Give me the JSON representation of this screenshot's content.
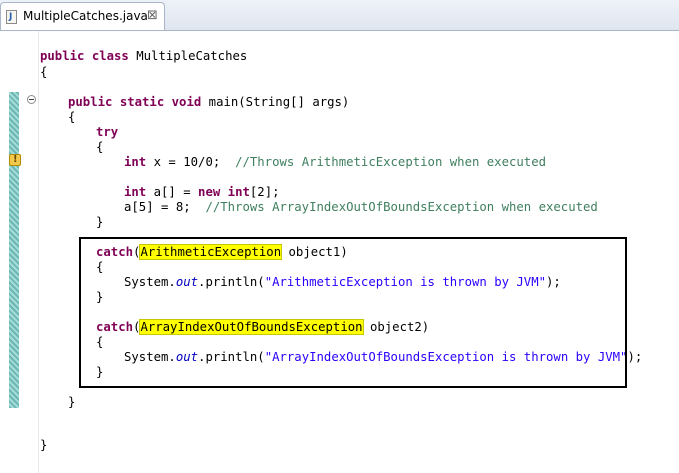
{
  "tab": {
    "icon": "java-file-icon",
    "title": "MultipleCatches.java",
    "close_label": "⊠"
  },
  "gutter": {
    "fold_icon": "collapse-icon",
    "warning_icon": "warning-icon"
  },
  "code": {
    "l1_kw": "public class",
    "l1_text": " MultipleCatches",
    "l2": "{",
    "l3_kw": "public static void",
    "l3_text": " main(String[] args)",
    "l4": "{",
    "l5_kw": "try",
    "l6": "{",
    "l7_kw": "int",
    "l7_text": " x = 10/0;  ",
    "l7_comment": "//Throws ArithmeticException when executed",
    "l8_kw1": "int",
    "l8_text1": " a[] = ",
    "l8_kw2": "new",
    "l8_text2": " ",
    "l8_kw3": "int",
    "l8_text3": "[2];",
    "l9_text": "a[5] = 8;  ",
    "l9_comment": "//Throws ArrayIndexOutOfBoundsException when executed",
    "l10": "}",
    "l11_kw": "catch",
    "l11_paren": "(",
    "l11_exc": "ArithmeticException",
    "l11_rest": " object1)",
    "l12": "{",
    "l13_pre": "System.",
    "l13_out": "out",
    "l13_mid": ".println(",
    "l13_str": "\"ArithmeticException is thrown by JVM\"",
    "l13_end": ");",
    "l14": "}",
    "l15_kw": "catch",
    "l15_paren": "(",
    "l15_exc": "ArrayIndexOutOfBoundsException",
    "l15_rest": " object2)",
    "l16": "{",
    "l17_pre": "System.",
    "l17_out": "out",
    "l17_mid": ".println(",
    "l17_str": "\"ArrayIndexOutOfBoundsException is thrown by JVM\"",
    "l17_end": ");",
    "l18": "}",
    "l19": "}",
    "l20": "}"
  }
}
